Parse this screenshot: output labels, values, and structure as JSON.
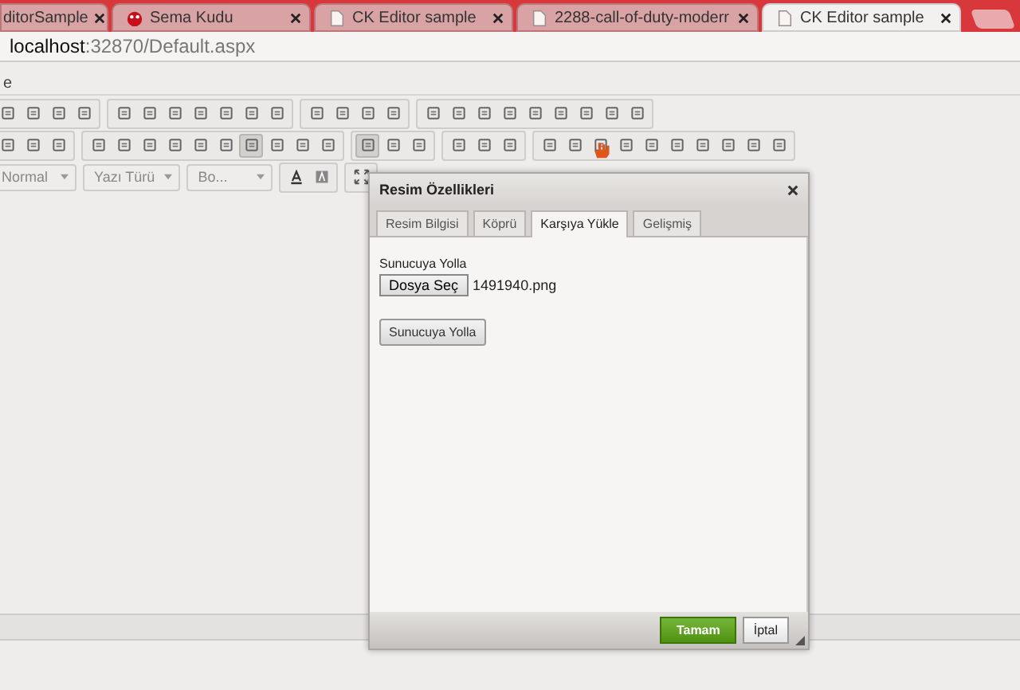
{
  "browser_tabs": [
    {
      "title": "ditorSample",
      "selected": false
    },
    {
      "title": "Sema Kudu",
      "selected": false
    },
    {
      "title": "CK Editor sample",
      "selected": false
    },
    {
      "title": "2288-call-of-duty-moderr",
      "selected": false
    },
    {
      "title": "CK Editor sample",
      "selected": true
    }
  ],
  "address": {
    "host": "localhost",
    "rest": ":32870/Default.aspx"
  },
  "bookmarks_bar": {
    "text": "e"
  },
  "toolbar": {
    "rows": [
      {
        "groups": [
          [
            {
              "selected": false
            },
            {
              "selected": false
            },
            {
              "selected": false
            },
            {
              "selected": false
            }
          ],
          [
            {
              "selected": false
            },
            {
              "selected": false
            },
            {
              "selected": false
            },
            {
              "selected": false
            },
            {
              "selected": false
            },
            {
              "selected": false
            },
            {
              "selected": false
            }
          ],
          [
            {
              "selected": false
            },
            {
              "selected": false
            },
            {
              "selected": false
            },
            {
              "selected": false
            }
          ],
          [
            {
              "selected": false
            },
            {
              "selected": false
            },
            {
              "selected": false
            },
            {
              "selected": false
            },
            {
              "selected": false
            },
            {
              "selected": false
            },
            {
              "selected": false
            },
            {
              "selected": false
            },
            {
              "selected": false
            }
          ]
        ]
      },
      {
        "groups": [
          [
            {
              "selected": false
            },
            {
              "selected": false
            },
            {
              "selected": false
            }
          ],
          [
            {
              "selected": false
            },
            {
              "selected": false
            },
            {
              "selected": false
            },
            {
              "selected": false
            },
            {
              "selected": false
            },
            {
              "selected": false
            },
            {
              "selected": true
            },
            {
              "selected": false
            },
            {
              "selected": false
            },
            {
              "selected": false
            }
          ],
          [
            {
              "selected": true
            },
            {
              "selected": false
            },
            {
              "selected": false
            }
          ],
          [
            {
              "selected": false
            },
            {
              "selected": false
            },
            {
              "selected": false
            }
          ],
          [
            {
              "selected": false
            },
            {
              "selected": false
            },
            {
              "selected": false
            },
            {
              "selected": false
            },
            {
              "selected": false
            },
            {
              "selected": false
            },
            {
              "selected": false
            },
            {
              "selected": false
            },
            {
              "selected": false
            },
            {
              "selected": false
            }
          ]
        ]
      }
    ],
    "combos": [
      "Normal",
      "Yazı Türü",
      "Bo..."
    ]
  },
  "dialog": {
    "title": "Resim Özellikleri",
    "tabs": [
      {
        "label": "Resim Bilgisi",
        "selected": false
      },
      {
        "label": "Köprü",
        "selected": false
      },
      {
        "label": "Karşıya Yükle",
        "selected": true
      },
      {
        "label": "Gelişmiş",
        "selected": false
      }
    ],
    "upload_label": "Sunucuya Yolla",
    "choose_button": "Dosya Seç",
    "file_name": "1491940.png",
    "send_button": "Sunucuya Yolla",
    "ok_button": "Tamam",
    "cancel_button": "İptal"
  }
}
